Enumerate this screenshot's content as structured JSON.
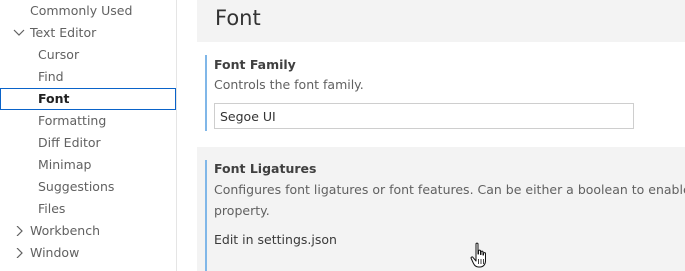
{
  "sidebar": {
    "items": [
      {
        "label": "Commonly Used",
        "chevron": null
      },
      {
        "label": "Text Editor",
        "chevron": "chevron-down"
      },
      {
        "label": "Cursor",
        "chevron": null
      },
      {
        "label": "Find",
        "chevron": null
      },
      {
        "label": "Font",
        "chevron": null,
        "selected": true
      },
      {
        "label": "Formatting",
        "chevron": null
      },
      {
        "label": "Diff Editor",
        "chevron": null
      },
      {
        "label": "Minimap",
        "chevron": null
      },
      {
        "label": "Suggestions",
        "chevron": null
      },
      {
        "label": "Files",
        "chevron": null
      },
      {
        "label": "Workbench",
        "chevron": "chevron-right"
      },
      {
        "label": "Window",
        "chevron": "chevron-right"
      }
    ]
  },
  "main": {
    "section_title": "Font",
    "settings": [
      {
        "title": "Font Family",
        "description": "Controls the font family.",
        "value": "Segoe UI"
      },
      {
        "title": "Font Ligatures",
        "description_line1": "Configures font ligatures or font features. Can be either a boolean to enable/disab",
        "description_line2": "property.",
        "link": "Edit in settings.json"
      }
    ]
  },
  "colors": {
    "selection_border": "#0a63c9",
    "setting_indicator": "#80b7e8",
    "header_background": "#f3f3f3"
  },
  "icons": {
    "expanded": "chevron-down-icon",
    "collapsed": "chevron-right-icon",
    "pointer": "hand-cursor-icon"
  }
}
